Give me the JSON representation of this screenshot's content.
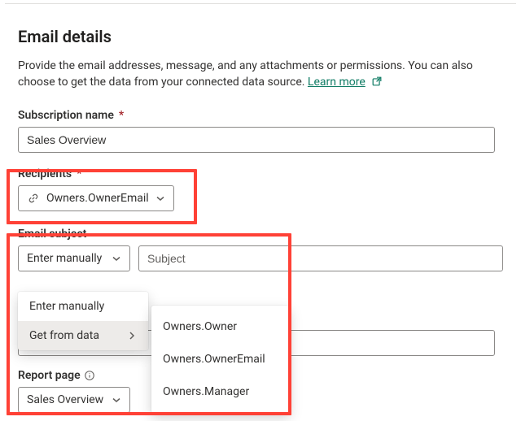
{
  "header": {
    "title": "Email details",
    "description_a": "Provide the email addresses, message, and any attachments or permissions. You can also choose to get the data from your connected data source. ",
    "learn_more": "Learn more"
  },
  "subscription": {
    "label": "Subscription name",
    "value": "Sales Overview"
  },
  "recipients": {
    "label": "Recipients",
    "chip_value": "Owners.OwnerEmail"
  },
  "subject": {
    "label": "Email subject",
    "mode_label": "Enter manually",
    "placeholder": "Subject"
  },
  "mode_menu": {
    "opt_manual": "Enter manually",
    "opt_data": "Get from data"
  },
  "data_menu": {
    "opt0": "Owners.Owner",
    "opt1": "Owners.OwnerEmail",
    "opt2": "Owners.Manager"
  },
  "report": {
    "label": "Report page",
    "value": "Sales Overview"
  }
}
